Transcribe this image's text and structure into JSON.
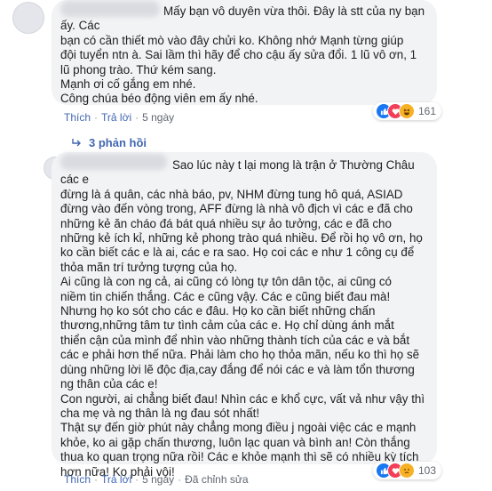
{
  "comment1": {
    "text": "Mấy bạn vô duyên vừa thôi. Đây là stt của ny bạn ấy. Các\nbạn có cần thiết mò vào đây chửi ko. Không nhớ Mạnh từng giúp\nđội tuyển ntn à. Sai lầm thì hãy để cho cậu ấy sửa đổi. 1 lũ vô ơn, 1\nlũ phong trào. Thứ kém sang.\nMạnh ơi cố gắng em nhé.\nCông chúa béo động viên em ấy nhé.",
    "like": "Thích",
    "reply": "Trả lời",
    "time": "5 ngày",
    "reaction_count": "161"
  },
  "replies_link": "3 phản hồi",
  "comment2": {
    "text": "Sao lúc này t lại mong là trận ở Thường Châu các e\nđừng là á quân, các nhà báo, pv, NHM đừng tung hô quá, ASIAD\nđừng vào đến vòng trong, AFF đừng là nhà vô địch vì các e đã cho\nnhững kẻ ăn cháo đá bát quá nhiều sự ảo tưởng, các e đã cho\nnhững kẻ ích kỉ, những kẻ phong trào quá nhiều. Để rồi họ vô ơn, họ\nko cần biết các e là ai, các e ra sao. Họ coi các e như 1 công cụ để\nthỏa mãn trí tưởng tượng của họ.\nAi cũng là con ng cả, ai cũng có lòng tự tôn dân tộc, ai cũng có\nniềm tin chiến thắng. Các e cũng vậy. Các e cũng biết đau mà!\nNhưng họ ko sót cho các e đâu. Họ ko cần biết những chấn\nthương,những tâm tư tình cảm của các e. Họ chỉ dùng ánh mắt\nthiển cận của mình để nhìn vào những thành tích của các e và bắt\ncác e phải hơn thế nữa. Phải làm cho họ thỏa mãn, nếu ko thì họ sẽ\ndùng những lời lẽ độc địa,cay đắng để nói các e và làm tổn thương\nng thân của các e!\nCon người, ai chẳng biết đau! Nhìn các e khổ cực, vất vả như vậy thì\ncha mẹ và ng thân là ng đau sót nhất!\nThật sự đến giờ phút này chẳng mong điều j ngoài việc các e mạnh\nkhỏe, ko ai gặp chấn thương, luôn lạc quan và bình an! Còn thắng\nthua ko quan trọng nữa rồi! Các e khỏe mạnh thì sẽ có nhiều kỳ tích\nhơn nữa! Ko phải vội!",
    "like": "Thích",
    "reply": "Trả lời",
    "time": "5 ngày",
    "edited": "Đã chỉnh sửa",
    "reaction_count": "103"
  },
  "icons": {
    "like": "like-icon",
    "love": "love-icon",
    "haha": "haha-icon",
    "sad": "sad-icon",
    "reply": "reply-arrow-icon"
  },
  "colors": {
    "bubble": "#f2f3f5",
    "link": "#4267b2",
    "meta": "#606770",
    "like": "#1877f2",
    "love": "#f33e58"
  }
}
